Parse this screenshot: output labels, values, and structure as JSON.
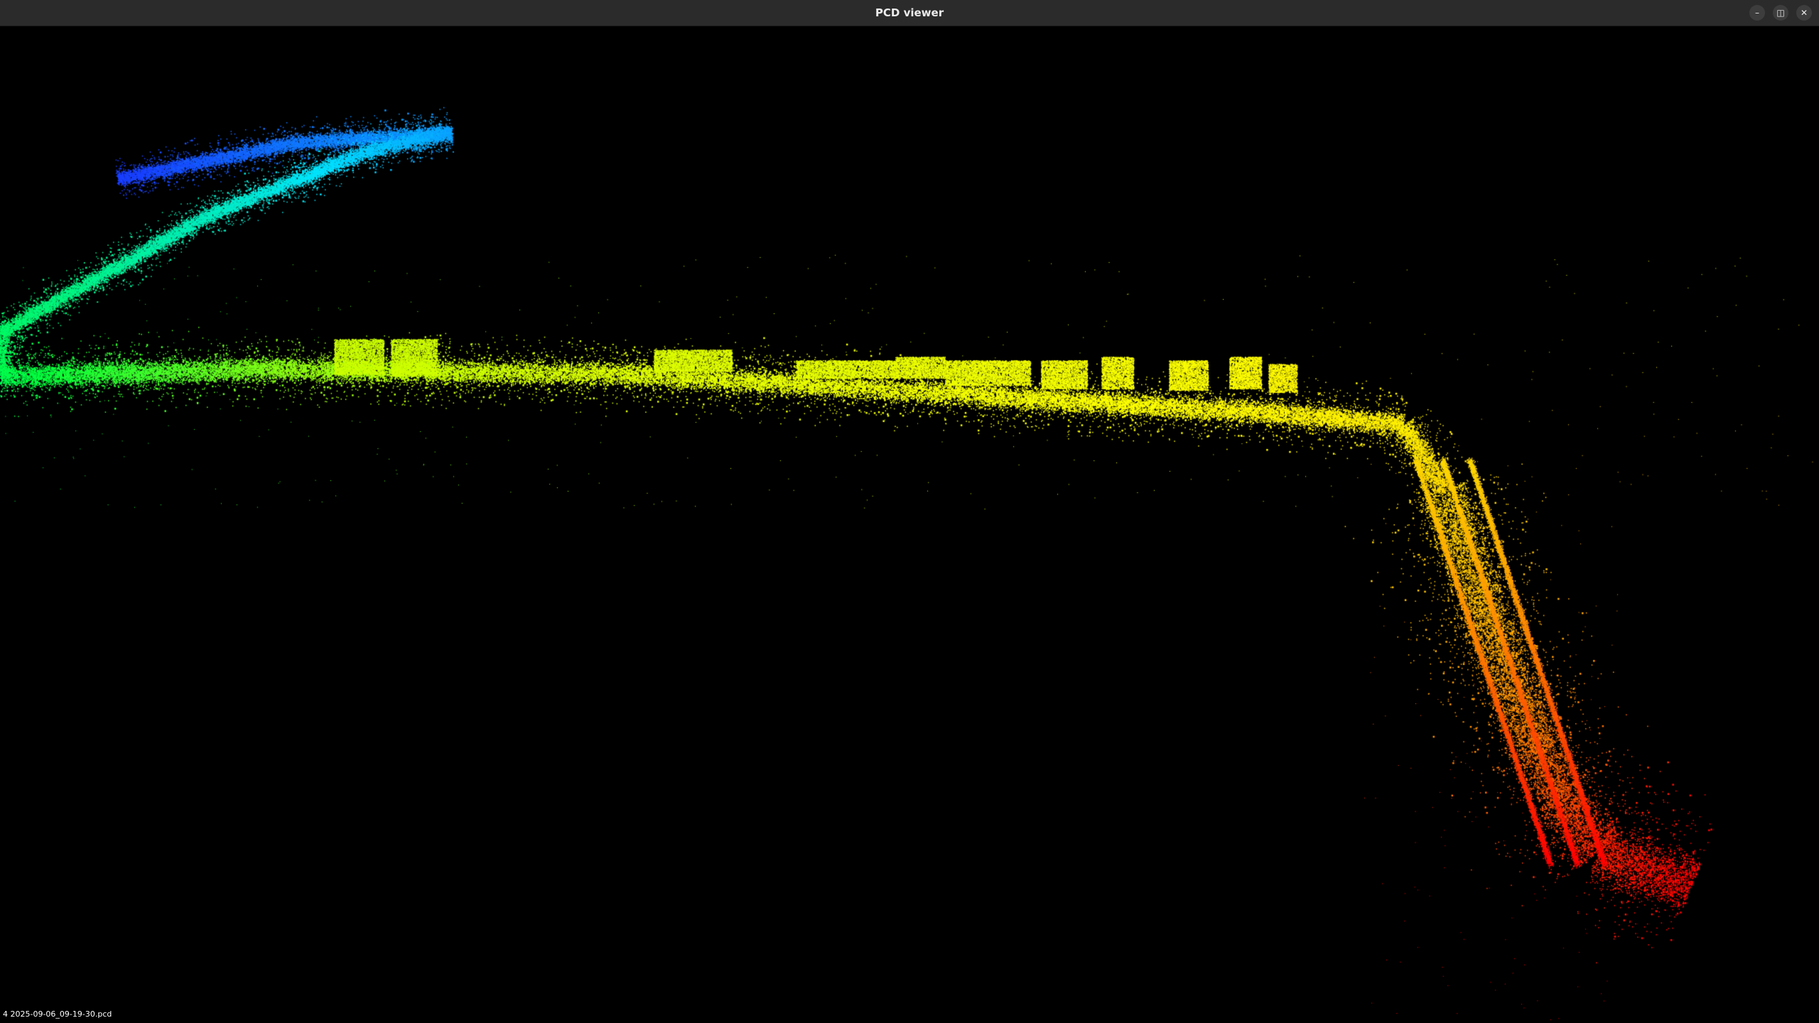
{
  "window": {
    "title": "PCD viewer",
    "controls": {
      "minimize_glyph": "–",
      "maximize_glyph": "◫",
      "close_glyph": "✕"
    }
  },
  "viewport": {
    "background_color": "#000000",
    "colormap": [
      "#1a3cff",
      "#00e5ff",
      "#00ff40",
      "#c8ff00",
      "#ffff00",
      "#ff8c00",
      "#ff0000"
    ],
    "file_label": "4 2025-09-06_09-19-30.pcd"
  }
}
